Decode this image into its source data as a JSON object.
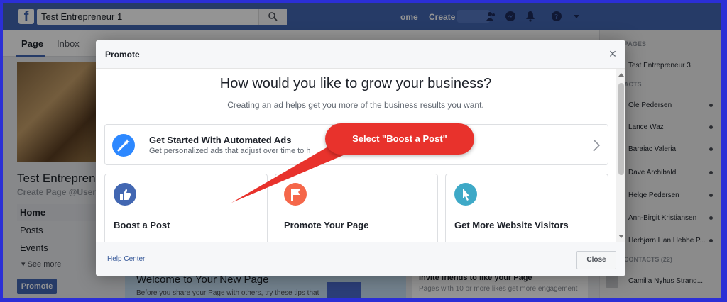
{
  "topbar": {
    "search_value": "Test Entrepreneur 1",
    "links": [
      "ome",
      "Create"
    ]
  },
  "page_tabs": [
    {
      "label": "Page",
      "active": true
    },
    {
      "label": "Inbox",
      "active": false
    }
  ],
  "left": {
    "page_name": "Test Entreprene",
    "page_handle": "Create Page @Usern",
    "nav": [
      {
        "label": "Home",
        "active": true
      },
      {
        "label": "Posts",
        "active": false
      },
      {
        "label": "Events",
        "active": false
      }
    ],
    "see_more": "See more",
    "promote_button": "Promote"
  },
  "background_cards": {
    "welcome_title": "Welcome to Your New Page",
    "welcome_text": "Before you share your Page with others, try these tips that",
    "invite_title": "Invite friends to like your Page",
    "invite_text": "Pages with 10 or more likes get more engagement"
  },
  "right_sidebar": {
    "pages_header": "PAGES",
    "page_item": "Test Entrepreneur 3",
    "contacts_header": "ACTS",
    "contacts": [
      "Ole Pedersen",
      "Lance Waz",
      "Baraiac Valeria",
      "Dave Archibald",
      "Helge Pedersen",
      "Ann-Birgit Kristiansen",
      "Herbjørn Han Hebbe P..."
    ],
    "more_contacts_header": "CONTACTS (22)",
    "more_contacts": [
      "Camilla Nyhus Strang..."
    ]
  },
  "modal": {
    "title": "Promote",
    "heading": "How would you like to grow your business?",
    "subheading": "Creating an ad helps get you more of the business results you want.",
    "automated": {
      "title": "Get Started With Automated Ads",
      "description": "Get personalized ads that adjust over time to h"
    },
    "options": [
      {
        "label": "Boost a Post",
        "icon": "thumbs-up-icon",
        "color": "#4267b2"
      },
      {
        "label": "Promote Your Page",
        "icon": "flag-icon",
        "color": "#f5674a"
      },
      {
        "label": "Get More Website Visitors",
        "icon": "cursor-icon",
        "color": "#3ea9c7"
      }
    ],
    "help_center": "Help Center",
    "close_button": "Close"
  },
  "annotation": {
    "callout_text": "Select \"Boost a Post\"",
    "color": "#e8322c"
  }
}
